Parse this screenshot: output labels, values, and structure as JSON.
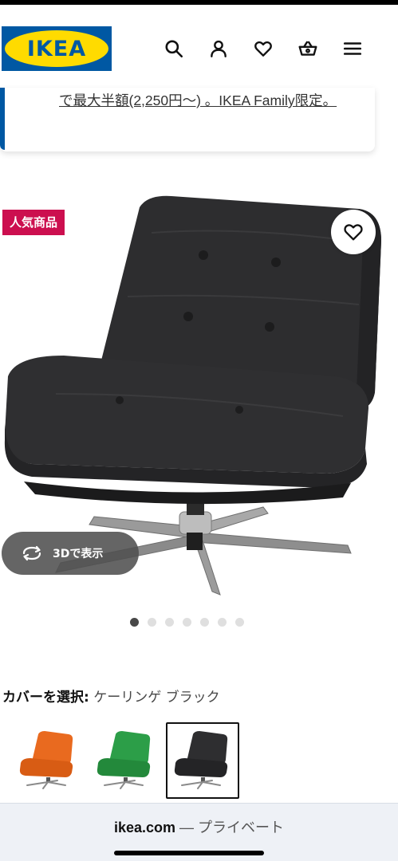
{
  "header": {
    "logo_text": "IKEA",
    "icons": [
      "search-icon",
      "user-icon",
      "heart-icon",
      "basket-icon",
      "menu-icon"
    ]
  },
  "promo": {
    "text": "で最大半額(2,250円〜) 。IKEA Family限定。"
  },
  "product": {
    "badge": "人気商品",
    "view_3d_label": "3Dで表示",
    "image_count": 7,
    "active_image": 1
  },
  "cover": {
    "label": "カバーを選択:",
    "value": "ケーリンゲ ブラック",
    "options": [
      {
        "color": "#e96a1f",
        "selected": false
      },
      {
        "color": "#2c9e48",
        "selected": false
      },
      {
        "color": "#2a2a2a",
        "selected": true
      }
    ]
  },
  "browser": {
    "domain": "ikea.com",
    "separator": "—",
    "mode": "プライベート"
  },
  "colors": {
    "brand_blue": "#0058a3",
    "brand_yellow": "#ffdb00",
    "badge_red": "#cc0f4f"
  }
}
